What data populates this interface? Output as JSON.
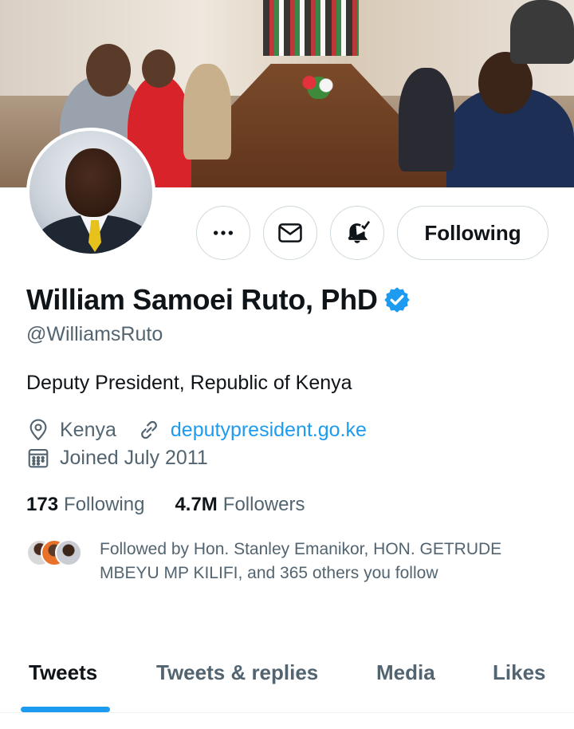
{
  "profile": {
    "name": "William Samoei Ruto, PhD",
    "handle": "@WilliamsRuto",
    "bio": "Deputy President, Republic of Kenya",
    "location": "Kenya",
    "website": "deputypresident.go.ke",
    "joined": "Joined July 2011",
    "verified": true
  },
  "actions": {
    "more_icon": "more-horizontal-icon",
    "message_icon": "envelope-icon",
    "notify_icon": "bell-check-icon",
    "follow_label": "Following"
  },
  "stats": {
    "following_count": "173",
    "following_label": "Following",
    "followers_count": "4.7M",
    "followers_label": "Followers"
  },
  "followed_by": {
    "text": "Followed by Hon. Stanley Emanikor, HON. GETRUDE MBEYU MP KILIFI, and 365 others you follow"
  },
  "tabs": [
    {
      "label": "Tweets",
      "active": true
    },
    {
      "label": "Tweets & replies",
      "active": false
    },
    {
      "label": "Media",
      "active": false
    },
    {
      "label": "Likes",
      "active": false
    }
  ],
  "colors": {
    "accent": "#1d9bf0",
    "text_primary": "#0f1419",
    "text_secondary": "#536471",
    "border": "#cfd9de"
  }
}
